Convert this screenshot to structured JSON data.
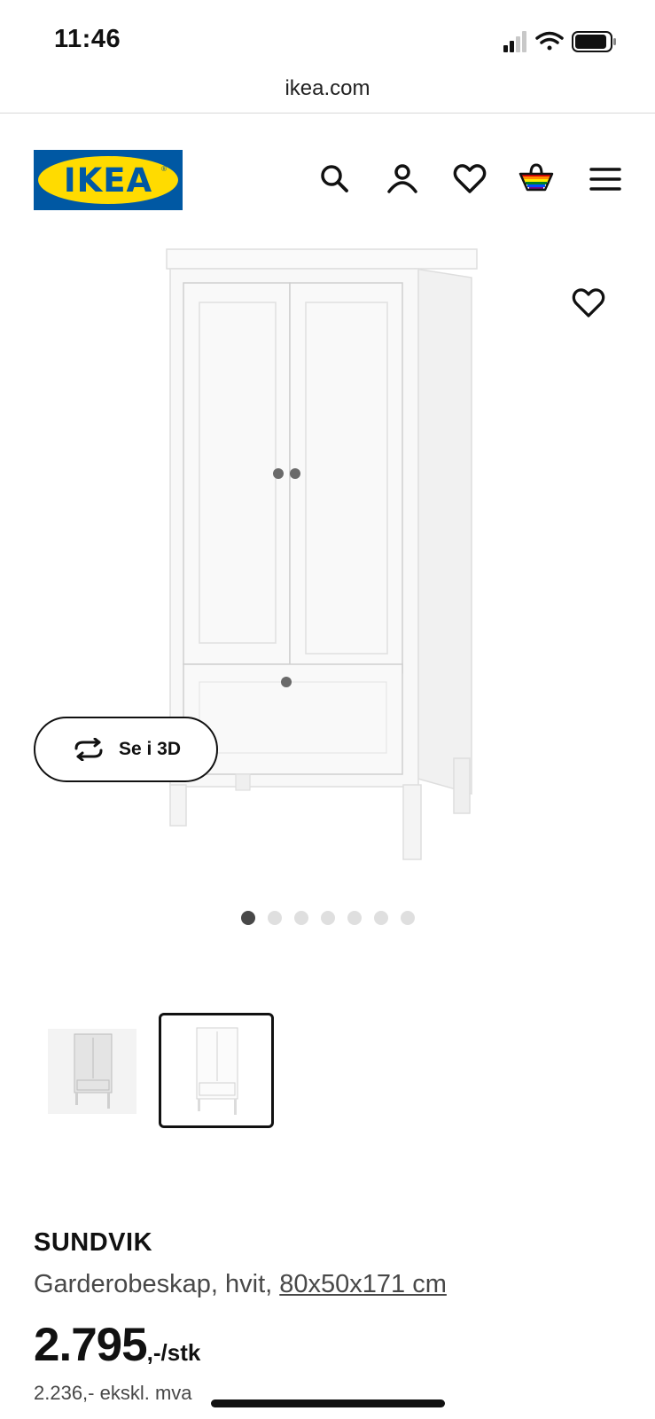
{
  "status_bar": {
    "time": "11:46",
    "icons": [
      "signal-icon",
      "wifi-icon",
      "battery-icon"
    ]
  },
  "browser": {
    "url": "ikea.com"
  },
  "header": {
    "logo_text": "IKEA",
    "icons": [
      "search-icon",
      "account-icon",
      "heart-icon",
      "shopping-bag-icon",
      "menu-icon"
    ],
    "brand_colors": {
      "blue": "#0058a3",
      "yellow": "#ffdb00"
    }
  },
  "gallery": {
    "view_3d_label": "Se i 3D",
    "dots_total": 7,
    "active_dot": 1,
    "thumbnails": [
      {
        "selected": false
      },
      {
        "selected": true
      }
    ]
  },
  "product": {
    "name": "SUNDVIK",
    "description": "Garderobeskap, hvit, ",
    "size": "80x50x171 cm",
    "price": "2.795",
    "price_suffix": ",-/stk",
    "price_ex_vat": "2.236,- ekskl. mva"
  }
}
